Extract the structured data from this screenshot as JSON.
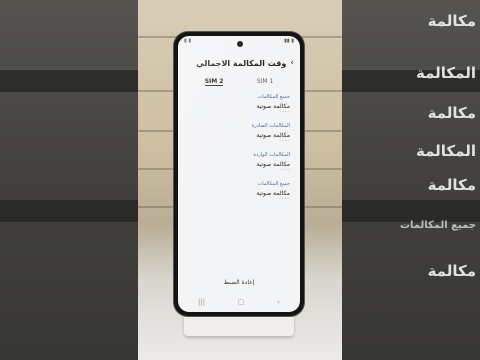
{
  "phone": {
    "page_title": "وقت المكالمة الاجمالي",
    "tabs": [
      "SIM 1",
      "SIM 2"
    ],
    "active_tab": "SIM 2",
    "sections": [
      {
        "header": "جميع المكالمات",
        "item_title": "مكالمة صوتية",
        "item_value": "- - - -"
      },
      {
        "header": "المكالمات الصادرة",
        "item_title": "مكالمة صوتية",
        "item_value": "- - - -"
      },
      {
        "header": "المكالمات الواردة",
        "item_title": "مكالمة صوتية",
        "item_value": "- - - -"
      },
      {
        "header": "جميع المكالمات",
        "item_title": "مكالمة صوتية",
        "item_value": "- - - -"
      }
    ],
    "reset_label": "إعادة الضبط",
    "nav": {
      "back": "‹",
      "home": "▢",
      "recents": "|||"
    }
  },
  "background_echo": {
    "lines": [
      "مكالمة",
      "المكالمة",
      "مكالمة",
      "المكالمة",
      "مكالمة",
      "جميع المكالمات",
      "مكالمة"
    ]
  },
  "colors": {
    "screen": "#f3f4f6",
    "accent": "#4a6fa5",
    "frame": "#141414"
  }
}
